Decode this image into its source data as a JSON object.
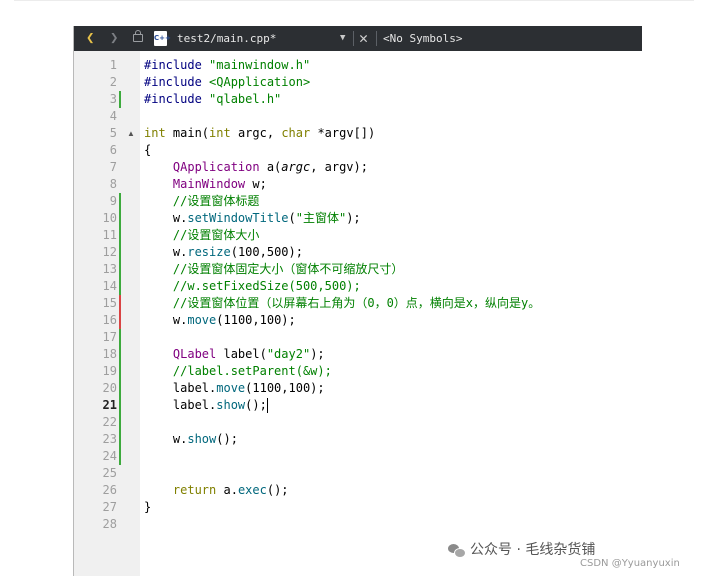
{
  "toolbar": {
    "back_icon": "chevron-left-icon",
    "forward_icon": "chevron-right-icon",
    "lock_icon": "lock-icon",
    "file_type_icon": "cpp-file-icon",
    "file_type_label": "C++",
    "file_name": "test2/main.cpp*",
    "dropdown_glyph": "▼",
    "close_glyph": "✕",
    "symbols": "<No Symbols>"
  },
  "editor": {
    "current_line": 21,
    "colors": {
      "keyword": "#808000",
      "string": "#008000",
      "class": "#800080",
      "comment": "#008000",
      "method": "#00677c",
      "number": "#000080",
      "marker_saved": "#3daa3d",
      "marker_unsaved": "#d94343"
    },
    "lines": [
      {
        "n": "1",
        "mark": "",
        "tokens": [
          {
            "t": "#include ",
            "c": "#000080"
          },
          {
            "t": "\"mainwindow.h\"",
            "c": "#008000"
          }
        ]
      },
      {
        "n": "2",
        "mark": "",
        "tokens": [
          {
            "t": "#include ",
            "c": "#000080"
          },
          {
            "t": "<QApplication>",
            "c": "#008000"
          }
        ]
      },
      {
        "n": "3",
        "mark": "g",
        "tokens": [
          {
            "t": "#include ",
            "c": "#000080"
          },
          {
            "t": "\"qlabel.h\"",
            "c": "#008000"
          }
        ]
      },
      {
        "n": "4",
        "mark": "",
        "tokens": []
      },
      {
        "n": "5",
        "mark": "",
        "fold": "▲",
        "tokens": [
          {
            "t": "int",
            "c": "#808000"
          },
          {
            "t": " main(",
            "c": "#000000"
          },
          {
            "t": "int",
            "c": "#808000"
          },
          {
            "t": " argc, ",
            "c": "#000000"
          },
          {
            "t": "char",
            "c": "#808000"
          },
          {
            "t": " *argv[])",
            "c": "#000000"
          }
        ]
      },
      {
        "n": "6",
        "mark": "",
        "tokens": [
          {
            "t": "{",
            "c": "#000000"
          }
        ]
      },
      {
        "n": "7",
        "mark": "",
        "tokens": [
          {
            "t": "    QApplication",
            "c": "#800080"
          },
          {
            "t": " a(",
            "c": "#000000"
          },
          {
            "t": "argc",
            "c": "#000000",
            "i": true
          },
          {
            "t": ", argv);",
            "c": "#000000"
          }
        ]
      },
      {
        "n": "8",
        "mark": "",
        "tokens": [
          {
            "t": "    MainWindow",
            "c": "#800080"
          },
          {
            "t": " w;",
            "c": "#000000"
          }
        ]
      },
      {
        "n": "9",
        "mark": "g",
        "tokens": [
          {
            "t": "    //设置窗体标题",
            "c": "#008000"
          }
        ]
      },
      {
        "n": "10",
        "mark": "g",
        "tokens": [
          {
            "t": "    w.",
            "c": "#000000"
          },
          {
            "t": "setWindowTitle",
            "c": "#00677c"
          },
          {
            "t": "(",
            "c": "#000000"
          },
          {
            "t": "\"主窗体\"",
            "c": "#008000"
          },
          {
            "t": ");",
            "c": "#000000"
          }
        ]
      },
      {
        "n": "11",
        "mark": "g",
        "tokens": [
          {
            "t": "    //设置窗体大小",
            "c": "#008000"
          }
        ]
      },
      {
        "n": "12",
        "mark": "g",
        "tokens": [
          {
            "t": "    w.",
            "c": "#000000"
          },
          {
            "t": "resize",
            "c": "#00677c"
          },
          {
            "t": "(100,500);",
            "c": "#000000"
          }
        ]
      },
      {
        "n": "13",
        "mark": "g",
        "tokens": [
          {
            "t": "    //设置窗体固定大小（窗体不可缩放尺寸）",
            "c": "#008000"
          }
        ]
      },
      {
        "n": "14",
        "mark": "g",
        "tokens": [
          {
            "t": "    //w.setFixedSize(500,500);",
            "c": "#008000"
          }
        ]
      },
      {
        "n": "15",
        "mark": "r",
        "tokens": [
          {
            "t": "    //设置窗体位置（以屏幕右上角为（0，0）点，横向是x，纵向是y。",
            "c": "#008000"
          }
        ]
      },
      {
        "n": "16",
        "mark": "r",
        "tokens": [
          {
            "t": "    w.",
            "c": "#000000"
          },
          {
            "t": "move",
            "c": "#00677c"
          },
          {
            "t": "(1100,100);",
            "c": "#000000"
          }
        ]
      },
      {
        "n": "17",
        "mark": "g",
        "tokens": []
      },
      {
        "n": "18",
        "mark": "g",
        "tokens": [
          {
            "t": "    QLabel",
            "c": "#800080"
          },
          {
            "t": " label(",
            "c": "#000000"
          },
          {
            "t": "\"day2\"",
            "c": "#008000"
          },
          {
            "t": ");",
            "c": "#000000"
          }
        ]
      },
      {
        "n": "19",
        "mark": "g",
        "tokens": [
          {
            "t": "    //label.setParent(&w);",
            "c": "#008000"
          }
        ]
      },
      {
        "n": "20",
        "mark": "g",
        "tokens": [
          {
            "t": "    label.",
            "c": "#000000"
          },
          {
            "t": "move",
            "c": "#00677c"
          },
          {
            "t": "(1100,100);",
            "c": "#000000"
          }
        ]
      },
      {
        "n": "21",
        "mark": "g",
        "tokens": [
          {
            "t": "    label.",
            "c": "#000000"
          },
          {
            "t": "show",
            "c": "#00677c"
          },
          {
            "t": "();",
            "c": "#000000"
          }
        ]
      },
      {
        "n": "22",
        "mark": "g",
        "tokens": []
      },
      {
        "n": "23",
        "mark": "g",
        "tokens": [
          {
            "t": "    w.",
            "c": "#000000"
          },
          {
            "t": "show",
            "c": "#00677c"
          },
          {
            "t": "();",
            "c": "#000000"
          }
        ]
      },
      {
        "n": "24",
        "mark": "g",
        "tokens": []
      },
      {
        "n": "25",
        "mark": "",
        "tokens": []
      },
      {
        "n": "26",
        "mark": "",
        "tokens": [
          {
            "t": "    return",
            "c": "#808000"
          },
          {
            "t": " a.",
            "c": "#000000"
          },
          {
            "t": "exec",
            "c": "#00677c"
          },
          {
            "t": "();",
            "c": "#000000"
          }
        ]
      },
      {
        "n": "27",
        "mark": "",
        "tokens": [
          {
            "t": "}",
            "c": "#000000"
          }
        ]
      },
      {
        "n": "28",
        "mark": "",
        "tokens": []
      }
    ]
  },
  "watermark": {
    "icon": "wechat-icon",
    "text": "公众号 · 毛线杂货铺"
  },
  "credit": "CSDN @Yyuanyuxin"
}
